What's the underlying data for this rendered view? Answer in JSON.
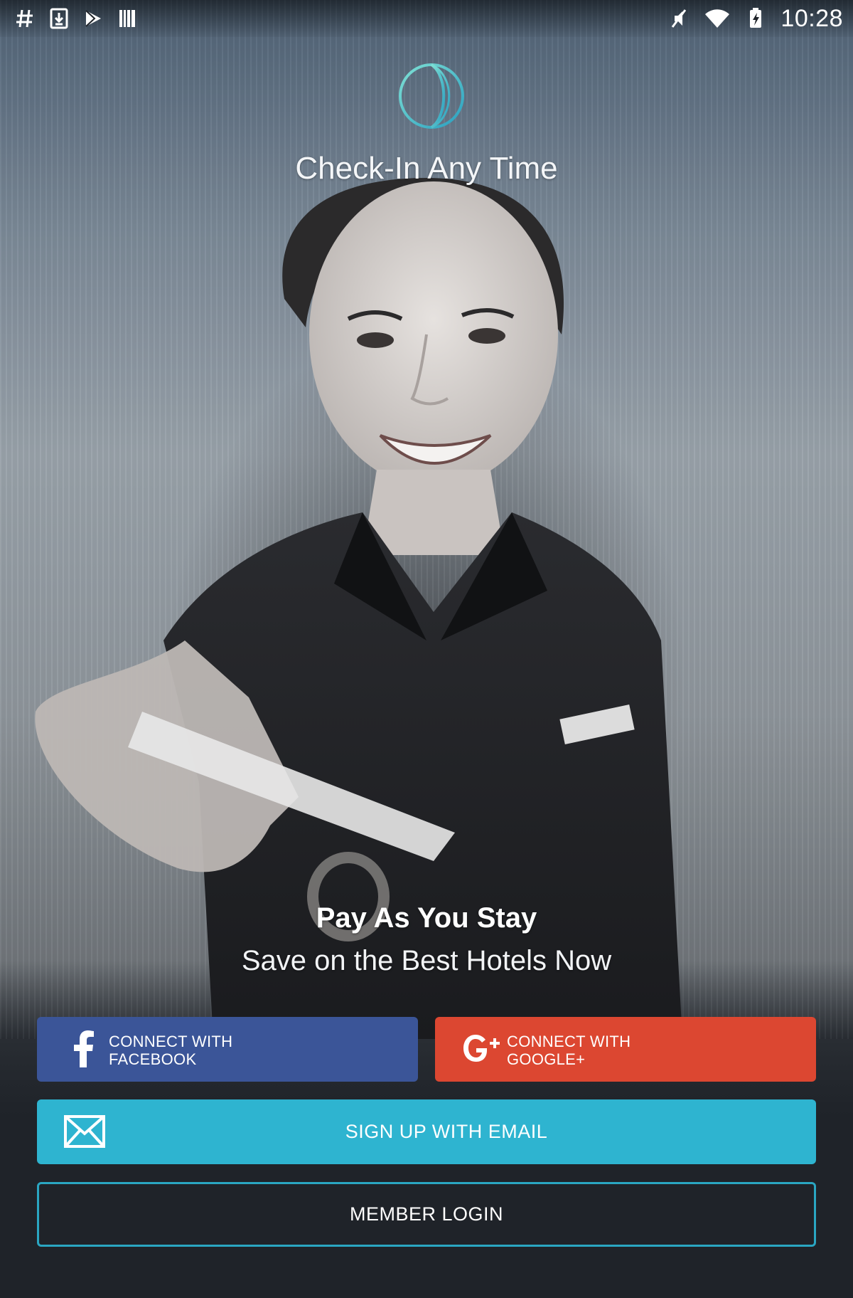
{
  "status_bar": {
    "time": "10:28",
    "left_icons": [
      "hash-icon",
      "download-icon",
      "play-store-icon",
      "barcode-icon"
    ],
    "right_icons": [
      "mute-icon",
      "wifi-icon",
      "battery-charging-icon"
    ]
  },
  "header": {
    "logo": "globe-logo-icon",
    "title": "Check-In Any Time"
  },
  "tagline": {
    "headline": "Pay As You Stay",
    "subline": "Save on the Best Hotels Now"
  },
  "buttons": {
    "facebook": {
      "line1": "CONNECT WITH",
      "line2": "FACEBOOK",
      "icon": "facebook-icon",
      "color": "#3b5598"
    },
    "google": {
      "line1": "CONNECT WITH",
      "line2": "GOOGLE+",
      "icon": "google-plus-icon",
      "color": "#dc4731"
    },
    "email": {
      "label": "SIGN UP WITH EMAIL",
      "icon": "envelope-icon",
      "color": "#2eb4d0"
    },
    "login": {
      "label": "MEMBER LOGIN",
      "border_color": "#2aa6c2"
    }
  }
}
